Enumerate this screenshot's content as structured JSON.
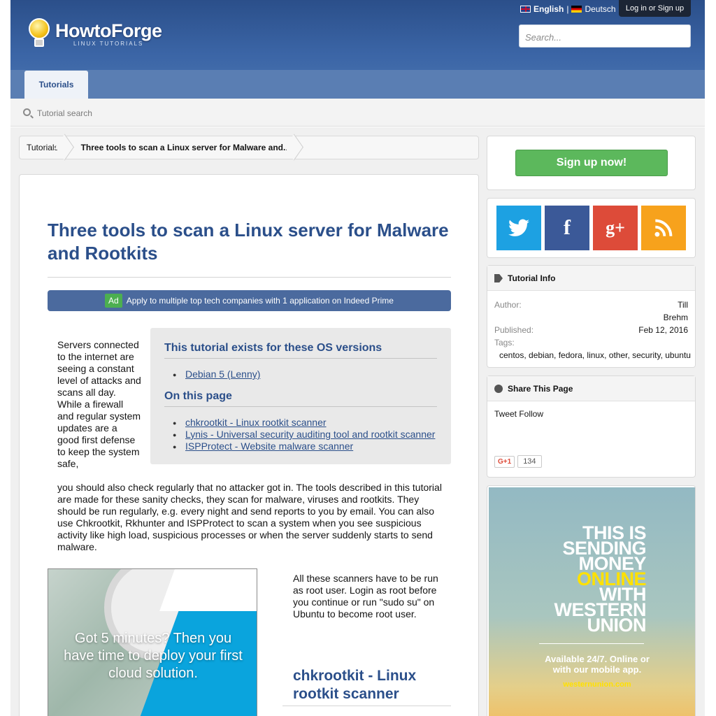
{
  "header": {
    "logo_name": "HowtoForge",
    "logo_sub": "LINUX TUTORIALS",
    "lang_en": "English",
    "lang_sep": "|",
    "lang_de": "Deutsch",
    "login": "Log in or Sign up",
    "search_placeholder": "Search...",
    "tab": "Tutorials"
  },
  "subbar": {
    "search": "Tutorial search"
  },
  "breadcrumb": [
    "Tutorials",
    "Three tools to scan a Linux server for Malware and.."
  ],
  "article": {
    "title": "Three tools to scan a Linux server for Malware and Rootkits",
    "ad_badge": "Ad",
    "ad_text": "Apply to multiple top tech companies with 1 application on Indeed Prime",
    "toc": {
      "os_heading": "This tutorial exists for these OS versions",
      "os_items": [
        "Debian 5 (Lenny)"
      ],
      "page_heading": "On this page",
      "page_items": [
        "chkrootkit - Linux rootkit scanner ",
        "Lynis - Universal security auditing tool and rootkit scanner ",
        "ISPProtect - Website malware scanner "
      ]
    },
    "intro_narrow": "Servers connected to the internet are seeing a constant level of attacks and scans all day. While a firewall and regular system updates are a good first defense to keep the system safe,",
    "intro_wide": "you should also check regularly that no attacker got in. The tools described in this tutorial are made for these sanity checks, they scan for malware, viruses and rootkits. They should be run regularly, e.g. every night and send reports to you by email. You can also use Chkrootkit, Rkhunter and ISPProtect to scan a system when you see suspicious activity like high load, suspicious processes or when the server suddenly starts to send malware.",
    "cloud_ad": "Got 5 minutes? Then you have time to deploy your first cloud solution.",
    "root_para": "All these scanners have to be run as root user. Login as root before you continue or run \"sudo su\" on Ubuntu to become root user.",
    "section_heading": "chkrootkit - Linux rootkit scanner"
  },
  "sidebar": {
    "signup": "Sign up now!",
    "social": {
      "twitter": "twitter-icon",
      "facebook": "f",
      "gplus": "g+",
      "rss": "rss-icon"
    },
    "info": {
      "heading": "Tutorial Info",
      "author_label": "Author:",
      "author_first": "Till",
      "author_last": "Brehm",
      "published_label": "Published:",
      "published": "Feb 12, 2016",
      "tags_label": "Tags:",
      "tags": "centos, debian, fedora, linux, other, security, ubuntu"
    },
    "share": {
      "heading": "Share This Page",
      "tweet": "Tweet Follow",
      "gplus": "G+1",
      "gplus_count": "134"
    },
    "wu_ad": {
      "line1": "THIS IS",
      "line2": "SENDING",
      "line3": "MONEY",
      "line4": "ONLINE",
      "line5": "WITH",
      "line6": "WESTERN",
      "line7": "UNION",
      "sub": "Available 24/7. Online or with our mobile app.",
      "link": "westernunion.com"
    }
  },
  "colors": {
    "brand_blue": "#2b4f8a",
    "signup_green": "#5cb85c",
    "twitter": "#1da1e2",
    "facebook": "#3b5998",
    "gplus": "#dd4b39",
    "rss": "#f7a21c"
  }
}
